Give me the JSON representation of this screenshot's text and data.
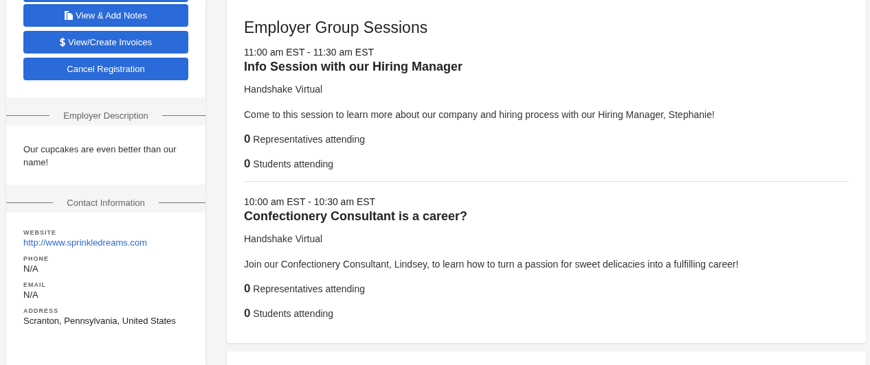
{
  "sidebar": {
    "buttons": [
      {
        "kind": "notes",
        "label": "View & Add Notes"
      },
      {
        "kind": "invoices",
        "label": "View/Create Invoices"
      },
      {
        "kind": "plain",
        "label": "Cancel Registration"
      }
    ],
    "description": {
      "heading": "Employer Description",
      "text": "Our cupcakes are even better than our name!"
    },
    "contact": {
      "heading": "Contact Information",
      "fields": [
        {
          "label": "WEBSITE",
          "value": "http://www.sprinkledreams.com",
          "kind": "link"
        },
        {
          "label": "PHONE",
          "value": "N/A",
          "kind": "text"
        },
        {
          "label": "EMAIL",
          "value": "N/A",
          "kind": "text"
        },
        {
          "label": "ADDRESS",
          "value": "Scranton, Pennsylvania, United States",
          "kind": "text"
        }
      ]
    }
  },
  "sessions": {
    "title": "Employer Group Sessions",
    "items": [
      {
        "time": "11:00 am EST - 11:30 am EST",
        "name": "Info Session with our Hiring Manager",
        "location": "Handshake Virtual",
        "description": "Come to this session to learn more about our company and hiring process with our Hiring Manager, Stephanie!",
        "representatives": "**0** Representatives attending",
        "students": "**0** Students attending"
      },
      {
        "time": "10:00 am EST - 10:30 am EST",
        "name": "Confectionery Consultant is a career?",
        "location": "Handshake Virtual",
        "description": "Join our Confectionery Consultant, Lindsey, to learn how to turn a passion for sweet delicacies into a fulfilling career!",
        "representatives": "**0** Representatives attending",
        "students": "**0** Students attending"
      }
    ]
  }
}
